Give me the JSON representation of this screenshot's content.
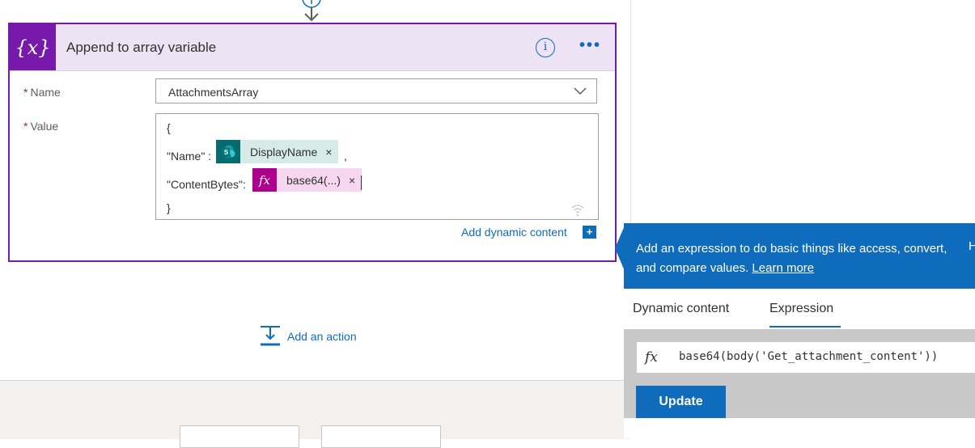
{
  "card": {
    "title": "Append to array variable",
    "icon_glyph": "{x}",
    "info_glyph": "i",
    "more_glyph": "•••",
    "accent": "#7719aa"
  },
  "fields": {
    "required_mark": "*",
    "name_label": "Name",
    "name_value": "AttachmentsArray",
    "value_label": "Value",
    "value_lines": {
      "open_brace": "{",
      "name_key": "\"Name\" :",
      "name_suffix": ",",
      "content_key": "\"ContentBytes\":",
      "close_brace": "}"
    },
    "tokens": {
      "display_name": {
        "label": "DisplayName",
        "remove": "×",
        "color": "#036c70"
      },
      "base64": {
        "label": "base64(...)",
        "remove": "×",
        "color": "#ad008c"
      }
    }
  },
  "add_dynamic_content": {
    "label": "Add dynamic content",
    "plus": "+"
  },
  "add_action": {
    "label": "Add an action"
  },
  "expression_panel": {
    "tip_text": "Add an expression to do basic things like access, convert, and compare values.",
    "tip_link": "Learn more",
    "tip_cut": "H",
    "tabs": [
      {
        "label": "Dynamic content",
        "active": false
      },
      {
        "label": "Expression",
        "active": true
      }
    ],
    "fx_symbol": "fx",
    "expression": "base64(body('Get_attachment_content'))",
    "update_label": "Update",
    "accent": "#0f6cbd"
  }
}
